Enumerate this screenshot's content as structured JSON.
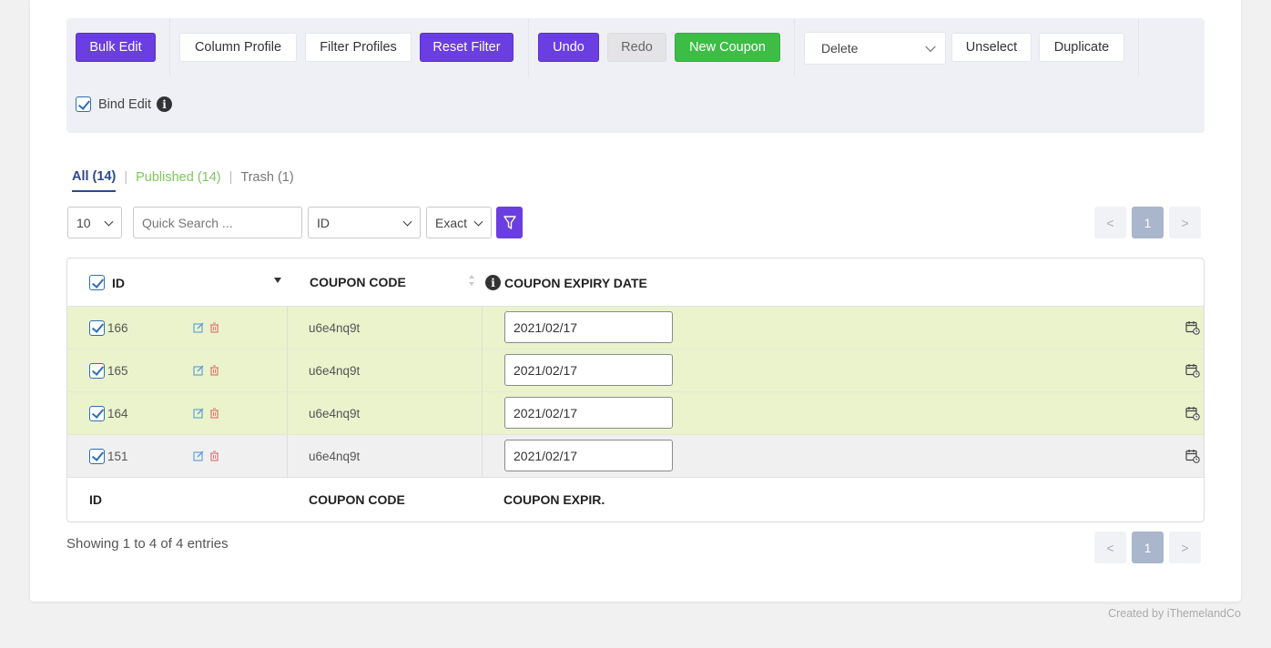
{
  "toolbar": {
    "bulk_edit": "Bulk Edit",
    "column_profile": "Column Profile",
    "filter_profiles": "Filter Profiles",
    "reset_filter": "Reset Filter",
    "undo": "Undo",
    "redo": "Redo",
    "new_coupon": "New Coupon",
    "action_select": "Delete",
    "unselect": "Unselect",
    "duplicate": "Duplicate",
    "bind_edit_label": "Bind Edit",
    "bind_edit_checked": true
  },
  "tabs": [
    {
      "label": "All (14)",
      "active": true
    },
    {
      "label": "Published (14)",
      "active": false
    },
    {
      "label": "Trash (1)",
      "active": false
    }
  ],
  "controls": {
    "per_page": "10",
    "search_placeholder": "Quick Search ...",
    "search_field": "ID",
    "match_mode": "Exact"
  },
  "pagination": {
    "prev": "<",
    "current": "1",
    "next": ">"
  },
  "table": {
    "headers": {
      "id": "ID",
      "coupon_code": "COUPON CODE",
      "expiry": "COUPON EXPIRY DATE"
    },
    "footers": {
      "id": "ID",
      "coupon_code": "COUPON CODE",
      "expiry": "COUPON EXPIR."
    },
    "rows": [
      {
        "id": "166",
        "code": "u6e4nq9t",
        "expiry": "2021/02/17",
        "checked": true
      },
      {
        "id": "165",
        "code": "u6e4nq9t",
        "expiry": "2021/02/17",
        "checked": true
      },
      {
        "id": "164",
        "code": "u6e4nq9t",
        "expiry": "2021/02/17",
        "checked": true
      },
      {
        "id": "151",
        "code": "u6e4nq9t",
        "expiry": "2021/02/17",
        "checked": true
      }
    ]
  },
  "showing": "Showing 1 to 4 of 4 entries",
  "credit": "Created by iThemelandCo",
  "colors": {
    "purple": "#6a3ee0",
    "green": "#3dbd45",
    "row_highlight": "#eaf3cc",
    "published_tab": "#7dc75d"
  }
}
